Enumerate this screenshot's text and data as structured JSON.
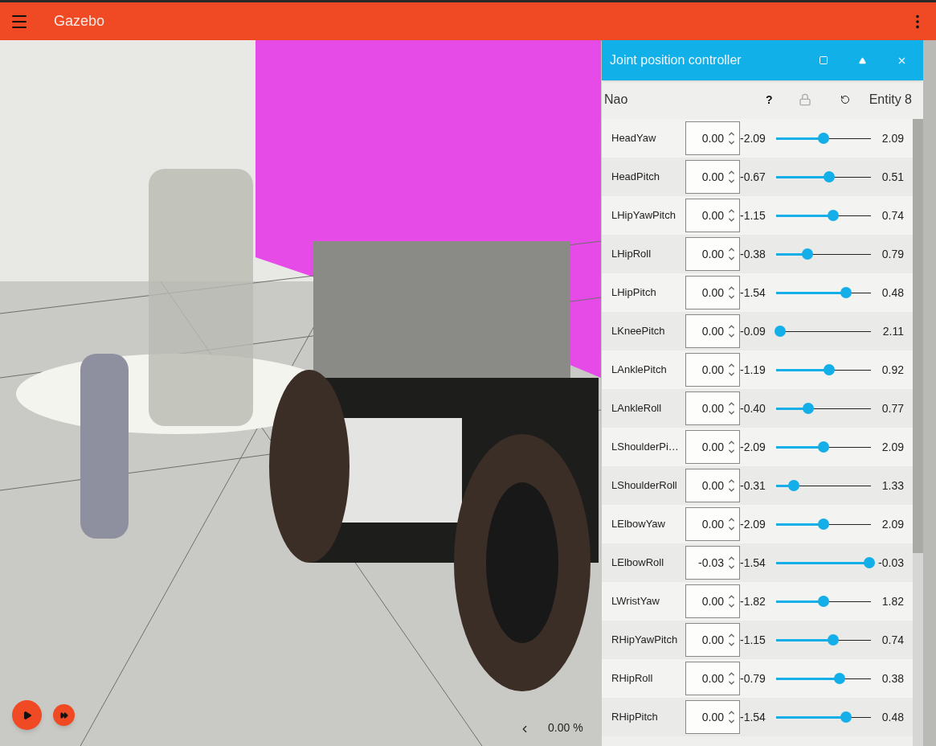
{
  "app_bar": {
    "title": "Gazebo"
  },
  "stats": {
    "real_time_factor": "0.00 %"
  },
  "panel": {
    "title": "Joint position controller",
    "model": "Nao",
    "help": "?",
    "entity": "Entity 8",
    "joints": [
      {
        "name": "HeadYaw",
        "value": "0.00",
        "min": "-2.09",
        "max": "2.09",
        "level": 0.5
      },
      {
        "name": "HeadPitch",
        "value": "0.00",
        "min": "-0.67",
        "max": "0.51",
        "level": 0.56
      },
      {
        "name": "LHipYawPitch",
        "value": "0.00",
        "min": "-1.15",
        "max": "0.74",
        "level": 0.6
      },
      {
        "name": "LHipRoll",
        "value": "0.00",
        "min": "-0.38",
        "max": "0.79",
        "level": 0.33
      },
      {
        "name": "LHipPitch",
        "value": "0.00",
        "min": "-1.54",
        "max": "0.48",
        "level": 0.74
      },
      {
        "name": "LKneePitch",
        "value": "0.00",
        "min": "-0.09",
        "max": "2.11",
        "level": 0.04
      },
      {
        "name": "LAnklePitch",
        "value": "0.00",
        "min": "-1.19",
        "max": "0.92",
        "level": 0.56
      },
      {
        "name": "LAnkleRoll",
        "value": "0.00",
        "min": "-0.40",
        "max": "0.77",
        "level": 0.34
      },
      {
        "name": "LShoulderPi…",
        "value": "0.00",
        "min": "-2.09",
        "max": "2.09",
        "level": 0.5
      },
      {
        "name": "LShoulderRoll",
        "value": "0.00",
        "min": "-0.31",
        "max": "1.33",
        "level": 0.19
      },
      {
        "name": "LElbowYaw",
        "value": "0.00",
        "min": "-2.09",
        "max": "2.09",
        "level": 0.5
      },
      {
        "name": "LElbowRoll",
        "value": "-0.03",
        "min": "-1.54",
        "max": "-0.03",
        "level": 0.98
      },
      {
        "name": "LWristYaw",
        "value": "0.00",
        "min": "-1.82",
        "max": "1.82",
        "level": 0.5
      },
      {
        "name": "RHipYawPitch",
        "value": "0.00",
        "min": "-1.15",
        "max": "0.74",
        "level": 0.6
      },
      {
        "name": "RHipRoll",
        "value": "0.00",
        "min": "-0.79",
        "max": "0.38",
        "level": 0.67
      },
      {
        "name": "RHipPitch",
        "value": "0.00",
        "min": "-1.54",
        "max": "0.48",
        "level": 0.74
      }
    ]
  }
}
